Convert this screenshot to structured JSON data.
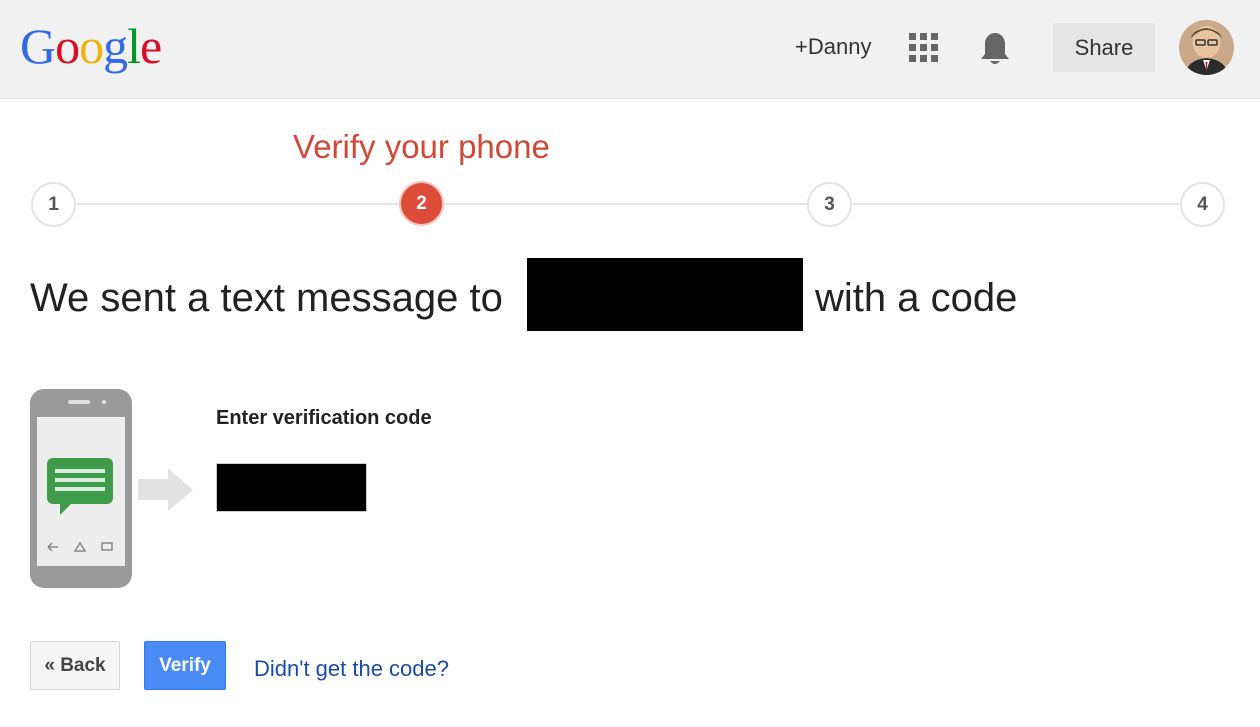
{
  "header": {
    "logo_letters": [
      {
        "char": "G",
        "color": "#3369e8"
      },
      {
        "char": "o",
        "color": "#d50f25"
      },
      {
        "char": "o",
        "color": "#eeb211"
      },
      {
        "char": "g",
        "color": "#3369e8"
      },
      {
        "char": "l",
        "color": "#009925"
      },
      {
        "char": "e",
        "color": "#d50f25"
      }
    ],
    "user_link": "+Danny",
    "apps_icon": "apps-grid-icon",
    "notifications_icon": "bell-icon",
    "share_label": "Share",
    "avatar_icon": "user-avatar"
  },
  "stepper": {
    "title": "Verify your phone",
    "steps": [
      "1",
      "2",
      "3",
      "4"
    ],
    "active_step": 2,
    "active_color": "#dd4b39"
  },
  "message": {
    "prefix": "We sent a text message to",
    "suffix": "with a code",
    "phone_redacted": true
  },
  "code_entry": {
    "label": "Enter verification code",
    "value": ""
  },
  "actions": {
    "back_label": "« Back",
    "verify_label": "Verify",
    "resend_link": "Didn't get the code?"
  },
  "colors": {
    "header_bg": "#f1f1f1",
    "accent_red": "#dd4b39",
    "verify_blue": "#4a8af4",
    "link_blue": "#1a4ba8",
    "sms_bubble_green": "#3d9b4a"
  }
}
